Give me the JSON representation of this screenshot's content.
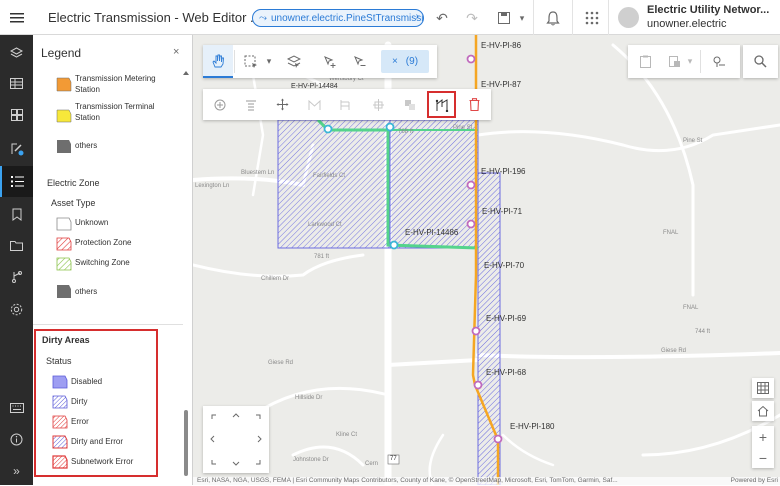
{
  "header": {
    "app_title": "Electric Transmission - Web Editor ...",
    "version": "unowner.electric.PineStTransmission",
    "user_name": "Electric Utility Networ...",
    "user_sub": "unowner.electric",
    "icons": [
      "hamburger-icon",
      "version-icon",
      "undo-icon",
      "redo-icon",
      "save-icon",
      "bell-icon",
      "apps-grid-icon",
      "user-avatar-icon"
    ]
  },
  "left_nav": {
    "items": [
      "layers-icon",
      "table-icon",
      "dashboard-icon",
      "editor-icon",
      "legend-icon",
      "bookmark-icon",
      "folder-icon",
      "trace-icon",
      "settings-icon",
      "keyboard-icon",
      "info-icon",
      "expand-icon"
    ],
    "active": "legend-icon"
  },
  "legend": {
    "title": "Legend",
    "close": "×",
    "station_items": [
      {
        "label1": "Transmission Metering",
        "label2": "Station",
        "color": "#f29a35"
      },
      {
        "label1": "Transmission Terminal",
        "label2": "Station",
        "color": "#f7e83a"
      },
      {
        "label1": "others",
        "label2": "",
        "color": "#6e6e6e"
      }
    ],
    "electric_zone": "Electric Zone",
    "asset_type": "Asset Type",
    "zone_items": [
      {
        "label": "Unknown"
      },
      {
        "label": "Protection Zone"
      },
      {
        "label": "Switching Zone"
      },
      {
        "label": "others"
      }
    ],
    "dirty_areas": "Dirty Areas",
    "status": "Status",
    "dirty_items": [
      {
        "label": "Disabled"
      },
      {
        "label": "Dirty"
      },
      {
        "label": "Error"
      },
      {
        "label": "Dirty and Error"
      },
      {
        "label": "Subnetwork Error"
      }
    ]
  },
  "selection_toolbar": {
    "selected_count": "(9)",
    "clear": "×"
  },
  "map": {
    "pole_labels": [
      "E-HV-Pl-86",
      "E-HV-Pl-87",
      "E-HV-Pl-196",
      "E-HV-Pl-71",
      "E-HV-Pl-14486",
      "E-HV-Pl-70",
      "E-HV-Pl-69",
      "E-HV-Pl-68",
      "E-HV-Pl-180",
      "E-HV-Pl-14484"
    ],
    "street_labels": [
      "Pine St",
      "Chillem Dr",
      "Giese Rd",
      "Giese Rd",
      "Hillside Dr",
      "Kline Ct",
      "Johnstone Dr",
      "Cern",
      "Fairfields Ct",
      "Larkwood Ct",
      "Bluestem Ln",
      "Lexington Ln",
      "FNAL",
      "FNAL",
      "Pine St",
      "Wensbury Ct"
    ],
    "elevation_labels": [
      "781 ft",
      "744 ft",
      "768 ft"
    ],
    "route_shield": "77",
    "attribution": "Esri, NASA, NGA, USGS, FEMA | Esri Community Maps Contributors, County of Kane, © OpenStreetMap, Microsoft, Esri, TomTom, Garmin, Saf...",
    "powered_by": "Powered by Esri"
  },
  "colors": {
    "accent": "#2b7bd6",
    "highlight_red": "#d62e2e",
    "power_line": "#f5a623",
    "selected_line": "#55d48c",
    "dirty_fill": "#7b7be6"
  }
}
